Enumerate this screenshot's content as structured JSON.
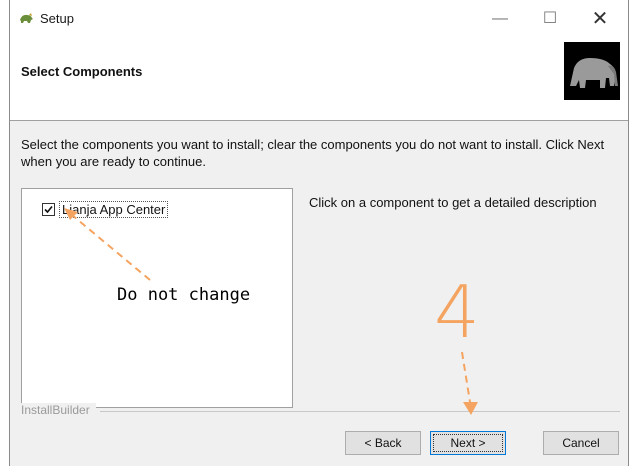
{
  "window": {
    "title": "Setup"
  },
  "header": {
    "title": "Select Components"
  },
  "description": "Select the components you want to install; clear the components you do not want to install. Click Next when you are ready to continue.",
  "components": [
    {
      "label": "Lianja App Center",
      "checked": true
    }
  ],
  "info_text": "Click on a component to get a detailed description",
  "footer": {
    "brand": "InstallBuilder"
  },
  "buttons": {
    "back": "< Back",
    "next": "Next >",
    "cancel": "Cancel"
  },
  "annotations": {
    "note": "Do not change",
    "step": "4",
    "color": "#f4a460"
  }
}
